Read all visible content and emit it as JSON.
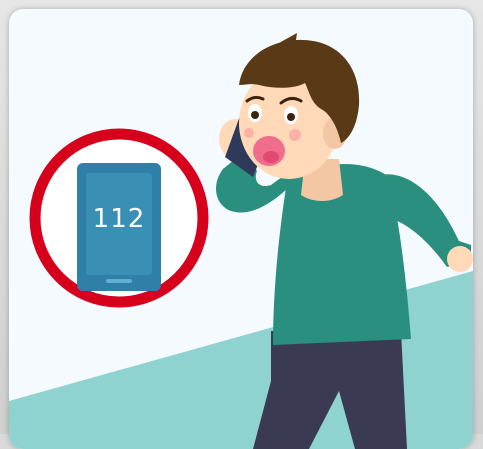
{
  "illustration": {
    "phone_number": "112",
    "colors": {
      "background": "#f4fafe",
      "ground": "#8fd3d1",
      "ring": "#d6001c",
      "phone_frame": "#2f7fa8",
      "phone_screen": "#3a8fb5",
      "shirt": "#2a8f7f",
      "pants": "#3a3a52",
      "hair": "#5a3a16",
      "skin": "#ffd9b8",
      "mouth": "#f06e8c"
    },
    "icons": [
      "emergency-phone-icon",
      "person-calling-icon"
    ]
  }
}
